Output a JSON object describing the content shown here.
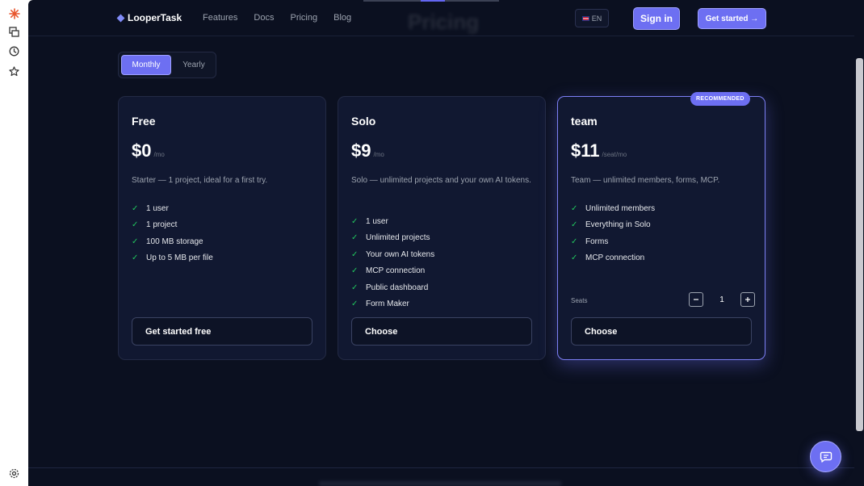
{
  "app": {
    "brand": "LooperTask",
    "ghost_title": "Pricing"
  },
  "nav": {
    "items": [
      "Features",
      "Docs",
      "Pricing",
      "Blog"
    ]
  },
  "header": {
    "lang_label": "EN",
    "sign_in": "Sign in",
    "get_started": "Get started →"
  },
  "billing_toggle": {
    "options": [
      "Monthly",
      "Yearly"
    ],
    "selected": "Monthly"
  },
  "plans": [
    {
      "name": "Free",
      "price": "$0",
      "period": "/mo",
      "description": "Starter — 1 project, ideal for a first try.",
      "features": [
        "1 user",
        "1 project",
        "100 MB storage",
        "Up to 5 MB per file"
      ],
      "cta": "Get started free"
    },
    {
      "name": "Solo",
      "price": "$9",
      "period": "/mo",
      "description": "Solo — unlimited projects and your own AI tokens.",
      "features": [
        "1 user",
        "Unlimited projects",
        "Your own AI tokens",
        "MCP connection",
        "Public dashboard",
        "Form Maker"
      ],
      "cta": "Choose"
    },
    {
      "name": "team",
      "price": "$11",
      "period": "/seat/mo",
      "badge": "RECOMMENDED",
      "description": "Team — unlimited members, forms, MCP.",
      "features": [
        "Unlimited members",
        "Everything in Solo",
        "Forms",
        "MCP connection"
      ],
      "seats_label": "Seats",
      "seats_value": "1",
      "cta": "Choose"
    }
  ],
  "icons": {
    "check": "check-icon",
    "chat": "chat-icon"
  },
  "colors": {
    "accent": "#6d6ff2",
    "background": "#0b1020",
    "card": "#111831",
    "check": "#22c55e"
  }
}
